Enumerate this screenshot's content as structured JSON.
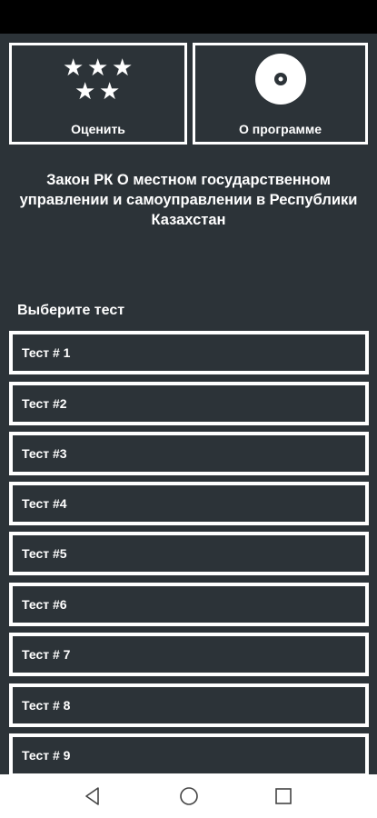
{
  "top_cards": {
    "rate": {
      "label": "Оценить",
      "icon": "stars-icon"
    },
    "about": {
      "label": "О программе",
      "icon": "disc-icon"
    }
  },
  "headline": "Закон РК О местном государственном управлении и самоуправлении в Республики Казахстан",
  "section_title": "Выберите тест",
  "tests": [
    {
      "label": "Тест # 1"
    },
    {
      "label": "Тест #2"
    },
    {
      "label": "Тест #3"
    },
    {
      "label": "Тест #4"
    },
    {
      "label": "Тест #5"
    },
    {
      "label": "Тест #6"
    },
    {
      "label": "Тест # 7"
    },
    {
      "label": "Тест # 8"
    },
    {
      "label": "Тест # 9"
    }
  ],
  "navbar": {
    "back": "back-icon",
    "home": "home-icon",
    "recents": "recents-icon"
  },
  "colors": {
    "background": "#2c3338",
    "border": "#ffffff",
    "text": "#ffffff"
  }
}
